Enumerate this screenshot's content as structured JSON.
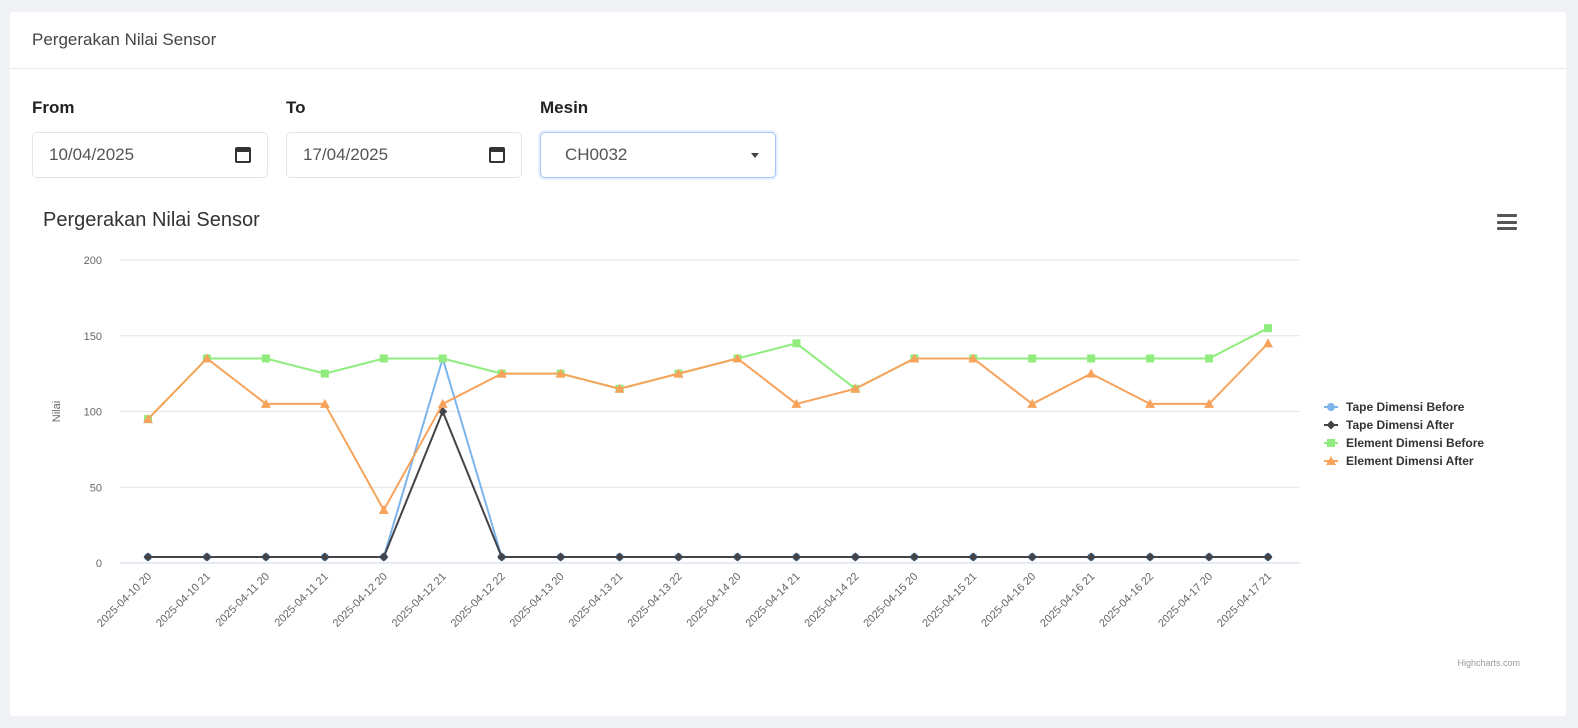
{
  "header": {
    "title": "Pergerakan Nilai Sensor"
  },
  "filters": {
    "from": {
      "label": "From",
      "value": "10/04/2025"
    },
    "to": {
      "label": "To",
      "value": "17/04/2025"
    },
    "mesin": {
      "label": "Mesin",
      "value": "CH0032"
    }
  },
  "chart_data": {
    "type": "line",
    "title": "Pergerakan Nilai Sensor",
    "ylabel": "Nilai",
    "xlabel": "",
    "ylim": [
      0,
      200
    ],
    "yticks": [
      0,
      50,
      100,
      150,
      200
    ],
    "grid": true,
    "legend_position": "right",
    "credits": "Highcharts.com",
    "categories": [
      "2025-04-10 20",
      "2025-04-10 21",
      "2025-04-11 20",
      "2025-04-11 21",
      "2025-04-12 20",
      "2025-04-12 21",
      "2025-04-12 22",
      "2025-04-13 20",
      "2025-04-13 21",
      "2025-04-13 22",
      "2025-04-14 20",
      "2025-04-14 21",
      "2025-04-14 22",
      "2025-04-15 20",
      "2025-04-15 21",
      "2025-04-16 20",
      "2025-04-16 21",
      "2025-04-16 22",
      "2025-04-17 20",
      "2025-04-17 21"
    ],
    "series": [
      {
        "name": "Tape Dimensi Before",
        "color": "#7cb5ec",
        "values": [
          4,
          4,
          4,
          4,
          4,
          135,
          4,
          4,
          4,
          4,
          4,
          4,
          4,
          4,
          4,
          4,
          4,
          4,
          4,
          4
        ]
      },
      {
        "name": "Tape Dimensi After",
        "color": "#434348",
        "values": [
          4,
          4,
          4,
          4,
          4,
          100,
          4,
          4,
          4,
          4,
          4,
          4,
          4,
          4,
          4,
          4,
          4,
          4,
          4,
          4
        ]
      },
      {
        "name": "Element Dimensi Before",
        "color": "#90ed7d",
        "values": [
          95,
          135,
          135,
          125,
          135,
          135,
          125,
          125,
          115,
          125,
          135,
          145,
          115,
          135,
          135,
          135,
          135,
          135,
          135,
          155
        ]
      },
      {
        "name": "Element Dimensi After",
        "color": "#f7a35c",
        "values": [
          95,
          135,
          105,
          105,
          35,
          105,
          125,
          125,
          115,
          125,
          135,
          105,
          115,
          135,
          135,
          105,
          125,
          105,
          105,
          145
        ]
      }
    ]
  }
}
